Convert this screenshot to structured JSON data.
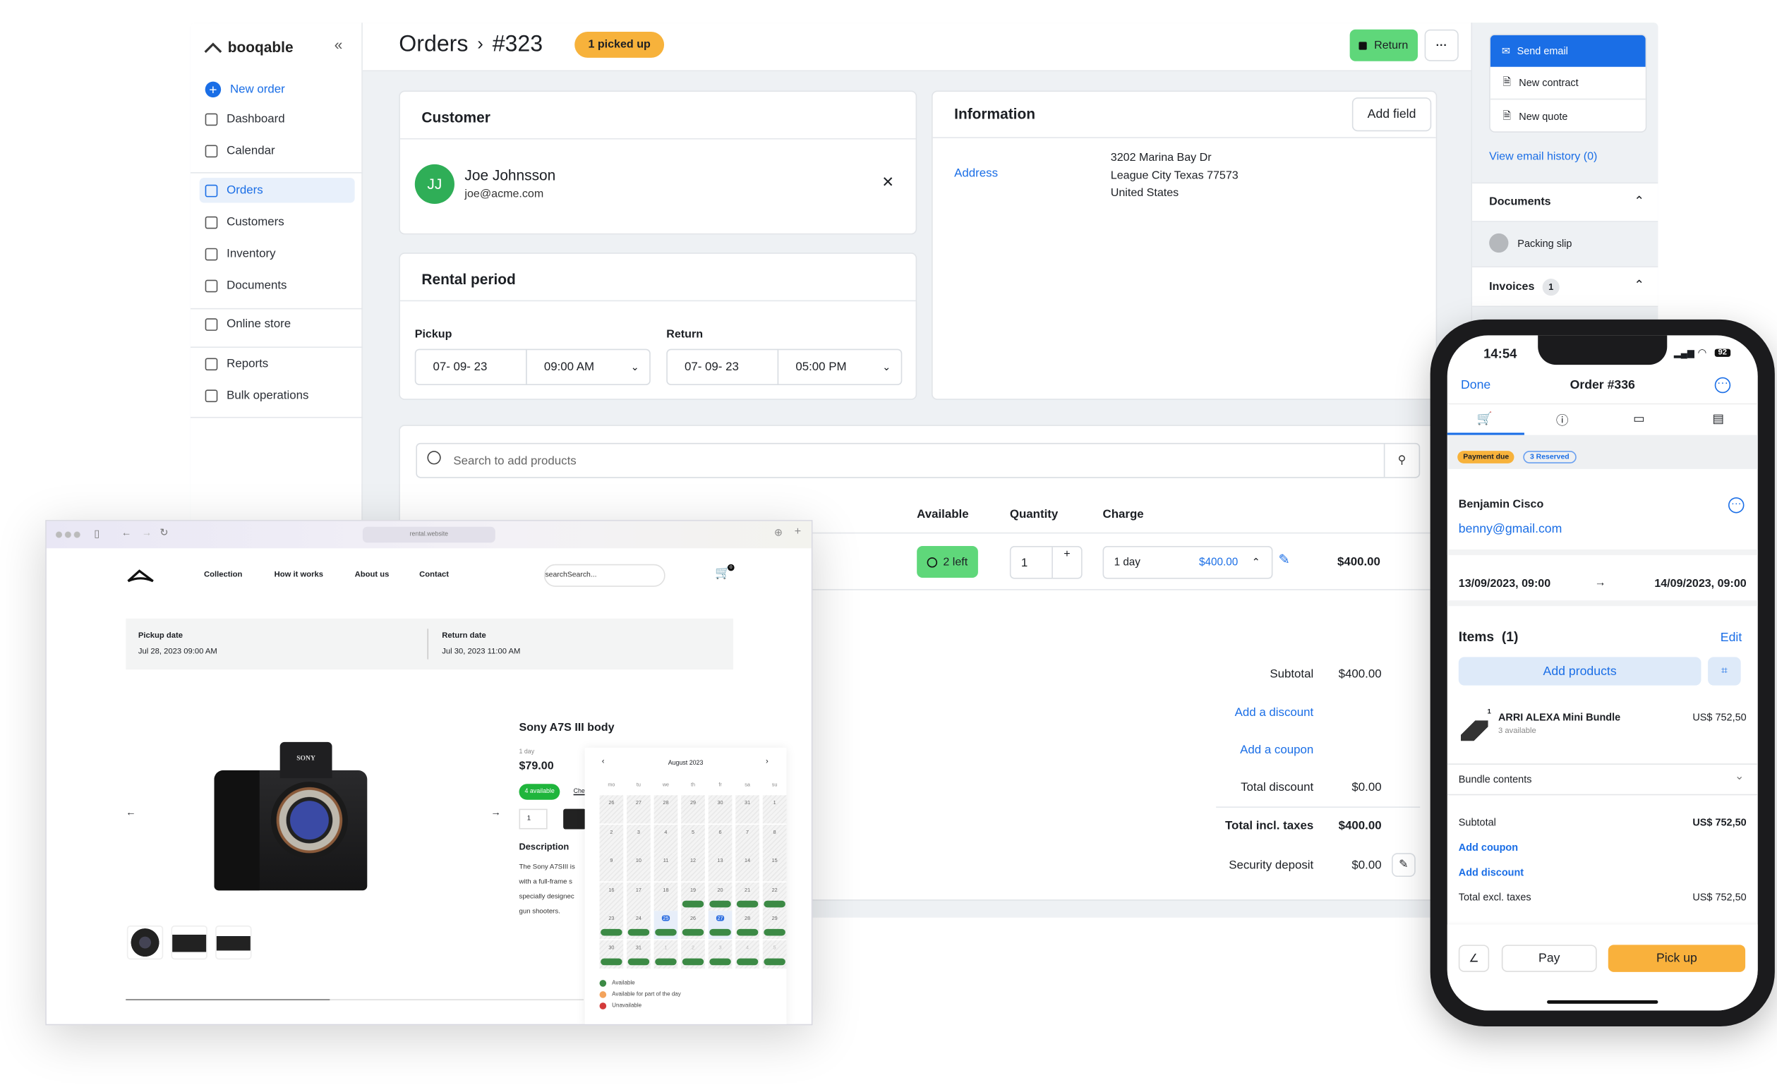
{
  "colors": {
    "accent": "#1a6ee6",
    "success": "#5fd77a",
    "badge_orange": "#f7b23b",
    "phone_pickup": "#f9b13c"
  },
  "sidebar": {
    "brand": "booqable",
    "collapse_icon": "double-chevron-left-icon",
    "new_order": "New order",
    "items": [
      {
        "label": "Dashboard",
        "icon": "dashboard-icon"
      },
      {
        "label": "Calendar",
        "icon": "calendar-icon"
      },
      {
        "label": "Orders",
        "icon": "orders-icon",
        "active": true
      },
      {
        "label": "Customers",
        "icon": "user-icon"
      },
      {
        "label": "Inventory",
        "icon": "inventory-icon"
      },
      {
        "label": "Documents",
        "icon": "document-icon"
      },
      {
        "label": "Online store",
        "icon": "store-icon"
      },
      {
        "label": "Reports",
        "icon": "reports-icon"
      },
      {
        "label": "Bulk operations",
        "icon": "bulk-icon"
      }
    ]
  },
  "header": {
    "breadcrumb_root": "Orders",
    "separator": "›",
    "order_number": "#323",
    "status_badge": "1 picked up",
    "return_button": "Return",
    "more_button": "···"
  },
  "customer": {
    "title": "Customer",
    "initials": "JJ",
    "name": "Joe Johnsson",
    "email": "joe@acme.com",
    "remove": "✕"
  },
  "rental_period": {
    "title": "Rental period",
    "pickup_label": "Pickup",
    "pickup_date": "07- 09- 23",
    "pickup_time": "09:00 AM",
    "return_label": "Return",
    "return_date": "07- 09- 23",
    "return_time": "05:00 PM"
  },
  "information": {
    "title": "Information",
    "add_field": "Add field",
    "address_label": "Address",
    "address_lines": [
      "3202 Marina Bay Dr",
      "League City Texas 77573",
      "United States"
    ]
  },
  "products": {
    "search_placeholder": "Search to add products",
    "columns": {
      "available": "Available",
      "quantity": "Quantity",
      "charge": "Charge"
    },
    "row": {
      "available": "2 left",
      "quantity": "1",
      "charge_period": "1 day",
      "charge_amount": "$400.00",
      "total": "$400.00"
    },
    "totals": {
      "subtotal_label": "Subtotal",
      "subtotal": "$400.00",
      "add_discount": "Add a discount",
      "add_coupon": "Add a coupon",
      "total_discount_label": "Total discount",
      "total_discount": "$0.00",
      "total_label": "Total incl. taxes",
      "total": "$400.00",
      "deposit_label": "Security deposit",
      "deposit": "$0.00"
    }
  },
  "actions": {
    "send_email": "Send email",
    "new_contract": "New contract",
    "new_quote": "New quote",
    "email_history": "View email history (0)",
    "documents_title": "Documents",
    "packing_slip": "Packing slip",
    "invoices_title": "Invoices",
    "invoices_count": "1"
  },
  "browser": {
    "url": "rental.website",
    "nav": [
      "Collection",
      "How it works",
      "About us",
      "Contact"
    ],
    "search_placeholder": "searchSearch...",
    "cart_count": "0",
    "pickup_label": "Pickup date",
    "pickup_value": "Jul 28, 2023 09:00 AM",
    "return_label": "Return date",
    "return_value": "Jul 30, 2023 11:00 AM",
    "product_title": "Sony A7S III body",
    "price_period": "1 day",
    "price": "$79.00",
    "availability": "4 available",
    "check_link": "Che",
    "quantity": "1",
    "description_title": "Description",
    "description_lines": [
      "The Sony A7SIII is",
      "with a full-frame s",
      "specially designec",
      "gun shooters."
    ],
    "camera_brand": "SONY",
    "calendar": {
      "month": "August 2023",
      "weekdays": [
        "mo",
        "tu",
        "we",
        "th",
        "fr",
        "sa",
        "su"
      ],
      "weeks": [
        [
          "26",
          "27",
          "28",
          "29",
          "30",
          "31",
          "1"
        ],
        [
          "2",
          "3",
          "4",
          "5",
          "6",
          "7",
          "8"
        ],
        [
          "9",
          "10",
          "11",
          "12",
          "13",
          "14",
          "15"
        ],
        [
          "16",
          "17",
          "18",
          "19",
          "20",
          "21",
          "22"
        ],
        [
          "23",
          "24",
          "25",
          "26",
          "27",
          "28",
          "29"
        ],
        [
          "30",
          "31",
          "1",
          "2",
          "3",
          "4",
          "5"
        ]
      ],
      "available": [
        [],
        [],
        [],
        [
          3,
          4,
          5,
          6
        ],
        [
          0,
          1,
          2,
          3,
          4,
          5,
          6
        ],
        [
          0,
          1,
          2,
          3,
          4,
          5,
          6
        ]
      ],
      "selected": [
        "25",
        "27"
      ],
      "legend": [
        {
          "label": "Available",
          "color": "#3c8a45"
        },
        {
          "label": "Available for part of the day",
          "color": "#f3a35c"
        },
        {
          "label": "Unavailable",
          "color": "#d33a3a"
        }
      ]
    }
  },
  "phone": {
    "time": "14:54",
    "battery": "92",
    "done": "Done",
    "title": "Order #336",
    "tabs": [
      "cart-icon",
      "info-icon",
      "card-icon",
      "document-icon"
    ],
    "badges": [
      "Payment due",
      "3 Reserved"
    ],
    "customer_name": "Benjamin Cisco",
    "customer_email": "benny@gmail.com",
    "start": "13/09/2023, 09:00",
    "end": "14/09/2023, 09:00",
    "items_title": "Items  (1)",
    "edit": "Edit",
    "add_products": "Add products",
    "item": {
      "qty": "1",
      "name": "ARRI ALEXA Mini Bundle",
      "stock": "3 available",
      "price": "US$ 752,50"
    },
    "bundle_contents": "Bundle contents",
    "subtotal_label": "Subtotal",
    "subtotal": "US$ 752,50",
    "add_coupon": "Add coupon",
    "add_discount": "Add discount",
    "total_excl_label": "Total excl. taxes",
    "total_excl": "US$ 752,50",
    "pay": "Pay",
    "pickup": "Pick up"
  }
}
